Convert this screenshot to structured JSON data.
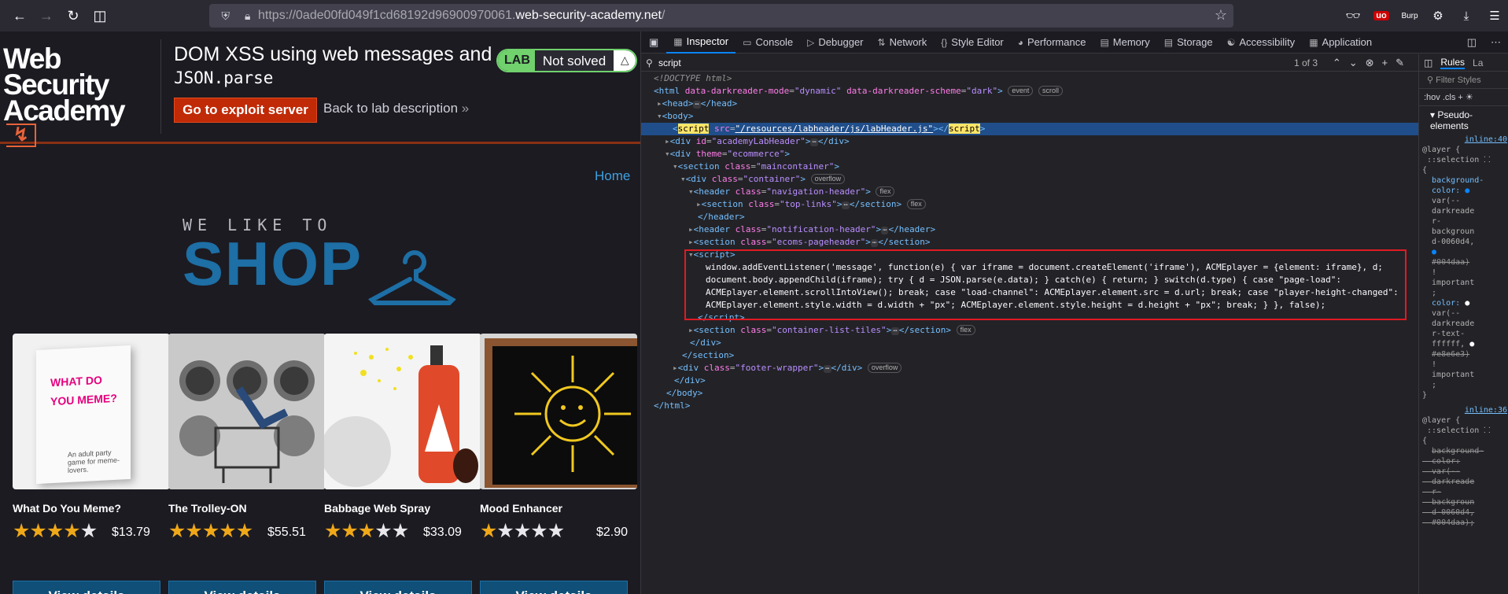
{
  "browser": {
    "url_scheme": "https://",
    "url_sub": "0ade00fd049f1cd68192d96900970061.",
    "url_domain": "web-security-academy.net",
    "url_path": "/",
    "burp_label": "Burp"
  },
  "lab": {
    "logo_line1": "Web Security",
    "logo_line2": "Academy",
    "title": "DOM XSS using web messages and",
    "title_code": "JSON.parse",
    "status_tag": "LAB",
    "status": "Not solved",
    "exploit_button": "Go to exploit server",
    "back_link": "Back to lab description",
    "home_link": "Home"
  },
  "banner": {
    "line1": "WE LIKE TO",
    "line2": "SHOP"
  },
  "products": [
    {
      "name": "What Do You Meme?",
      "rating": 4,
      "price": "$13.79",
      "button": "View details",
      "img_text": "WHAT DO YOU MEME?",
      "img_sub": "An adult party game for meme-lovers."
    },
    {
      "name": "The Trolley-ON",
      "rating": 5,
      "price": "$55.51",
      "button": "View details"
    },
    {
      "name": "Babbage Web Spray",
      "rating": 3,
      "price": "$33.09",
      "button": "View details"
    },
    {
      "name": "Mood Enhancer",
      "rating": 1,
      "price": "$2.90",
      "button": "View details"
    }
  ],
  "devtools": {
    "tabs": [
      "Inspector",
      "Console",
      "Debugger",
      "Network",
      "Style Editor",
      "Performance",
      "Memory",
      "Storage",
      "Accessibility",
      "Application"
    ],
    "active_tab": "Inspector",
    "search_query": "script",
    "search_count": "1 of 3",
    "script_code": [
      "window.addEventListener('message', function(e) { var iframe = document.createElement('iframe'), ACMEplayer = {element: iframe}, d;",
      "document.body.appendChild(iframe); try { d = JSON.parse(e.data); } catch(e) { return; } switch(d.type) { case \"page-load\":",
      "ACMEplayer.element.scrollIntoView(); break; case \"load-channel\": ACMEplayer.element.src = d.url; break; case \"player-height-changed\":",
      "ACMEplayer.element.style.width = d.width + \"px\"; ACMEplayer.element.style.height = d.height + \"px\"; break; } }, false);"
    ],
    "rules": {
      "tab_rules": "Rules",
      "tab_layout": "La",
      "filter": "Filter Styles",
      "tools": ":hov .cls",
      "pseudo": "Pseudo-elements",
      "link1": "inline:40",
      "link2": "inline:36"
    }
  },
  "colors": {
    "accent_orange": "#c02a07",
    "shop_blue": "#1d6fa5",
    "lab_green": "#70d16d",
    "devtools_selection": "#204e8a",
    "highlight_box": "#e01b24"
  }
}
